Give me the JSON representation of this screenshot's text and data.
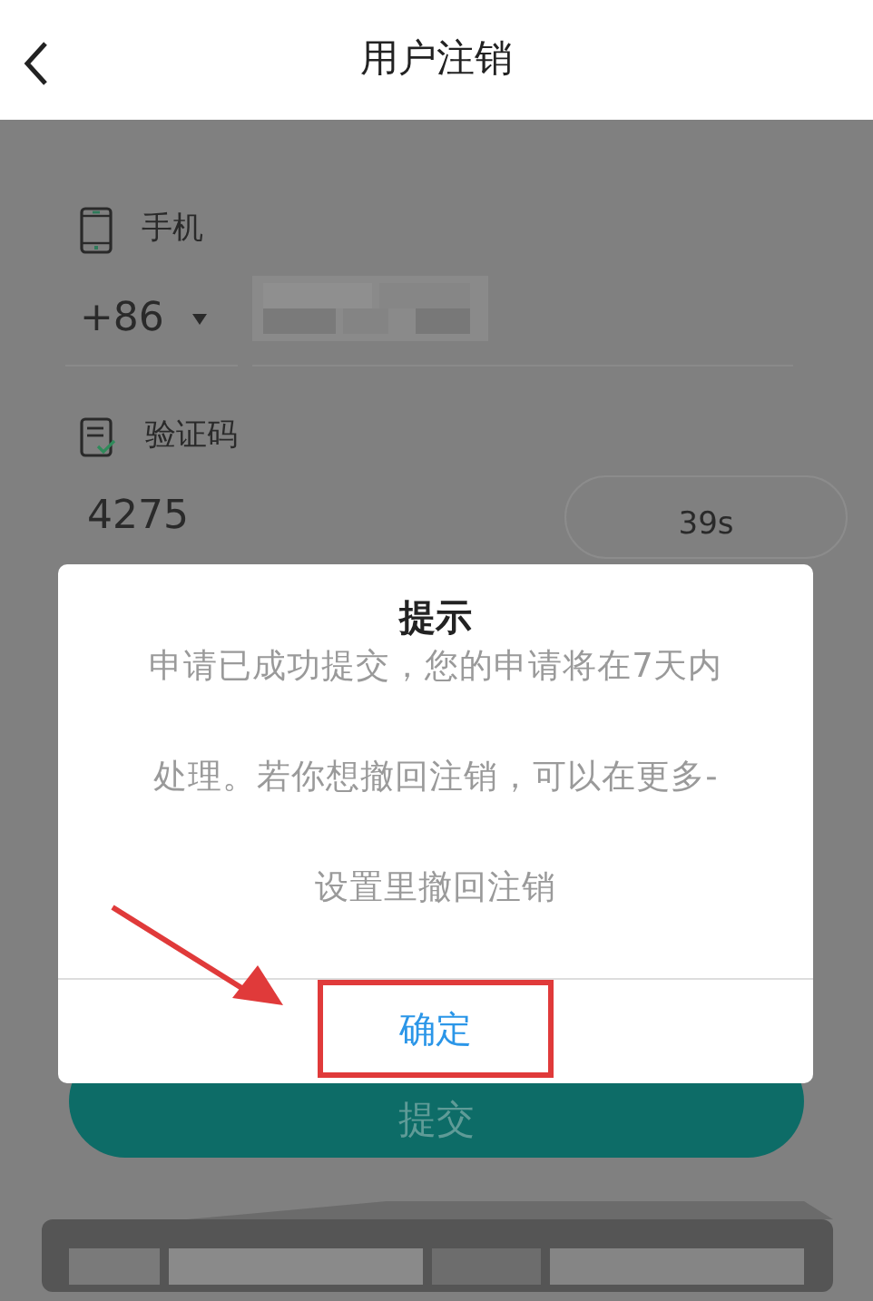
{
  "header": {
    "title": "用户注销"
  },
  "form": {
    "phone_label": "手机",
    "country_code": "+86",
    "code_label": "验证码",
    "code_value": "4275",
    "countdown": "39s"
  },
  "submit": {
    "label": "提交"
  },
  "dialog": {
    "title": "提示",
    "message": "申请已成功提交，您的申请将在7天内处理。若你想撤回注销，可以在更多-设置里撤回注销",
    "confirm": {
      "label": "确定",
      "highlighted": true
    }
  }
}
